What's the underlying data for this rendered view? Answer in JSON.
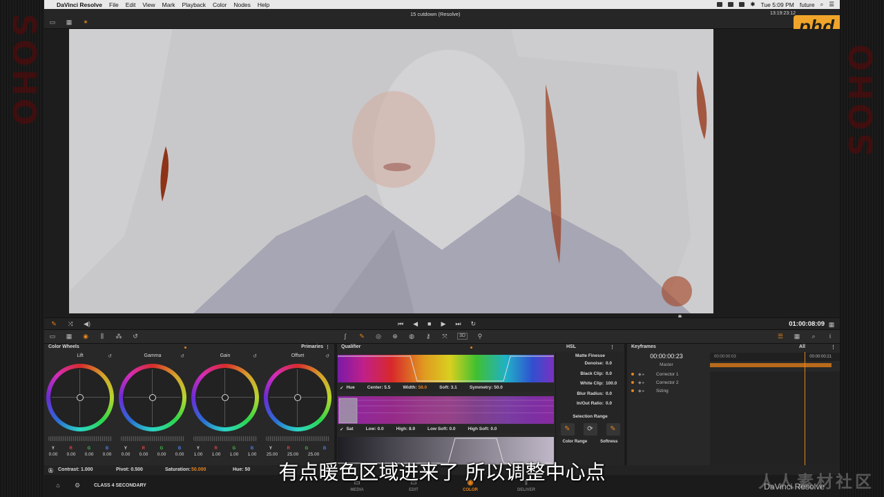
{
  "menubar": {
    "app": "DaVinci Resolve",
    "items": [
      "File",
      "Edit",
      "View",
      "Mark",
      "Playback",
      "Color",
      "Nodes",
      "Help"
    ],
    "clock": "Tue 5:09 PM",
    "user": "future"
  },
  "topbar": {
    "project_title": "15 cutdown (Resolve)",
    "timecode": "13:19:23:12",
    "logo": "phd"
  },
  "transport": {
    "timecode": "01:00:08:09"
  },
  "color_wheels": {
    "title": "Color Wheels",
    "mode": "Primaries",
    "wheels": [
      {
        "name": "Lift",
        "values": [
          "0.00",
          "0.00",
          "0.00",
          "0.00"
        ]
      },
      {
        "name": "Gamma",
        "values": [
          "0.00",
          "0.00",
          "0.00",
          "0.00"
        ]
      },
      {
        "name": "Gain",
        "values": [
          "1.00",
          "1.00",
          "1.00",
          "1.00"
        ]
      },
      {
        "name": "Offset",
        "values": [
          "25.00",
          "25.00",
          "25.00",
          ""
        ]
      }
    ],
    "channels": [
      "Y",
      "R",
      "G",
      "B"
    ]
  },
  "qualifier": {
    "title": "Qualifier",
    "mode": "HSL",
    "hue": {
      "label": "Hue",
      "center": "Center: 5.5",
      "width_label": "Width:",
      "width_value": "58.0",
      "soft": "Soft: 3.1",
      "symmetry": "Symmetry: 50.0"
    },
    "sat": {
      "label": "Sat",
      "low": "Low: 0.0",
      "high": "High: 8.9",
      "low_soft": "Low Soft: 0.0",
      "high_soft": "High Soft: 0.0"
    }
  },
  "matte_finesse": {
    "title": "Matte Finesse",
    "rows": [
      {
        "label": "Denoise:",
        "value": "0.0"
      },
      {
        "label": "Black Clip:",
        "value": "0.0"
      },
      {
        "label": "White Clip:",
        "value": "100.0"
      },
      {
        "label": "Blur Radius:",
        "value": "0.0"
      },
      {
        "label": "In/Out Ratio:",
        "value": "0.0"
      }
    ],
    "selection_range": "Selection Range",
    "color_range": "Color Range",
    "softness": "Softness"
  },
  "keyframes": {
    "title": "Keyframes",
    "filter": "All",
    "timecode": "00:00:00:23",
    "ruler_start": "00:00:00:03",
    "ruler_end": "00:00:00:21",
    "master": "Master",
    "rows": [
      "Corrector 1",
      "Corrector 2",
      "Sizing"
    ]
  },
  "status": {
    "contrast": "Contrast: 1.000",
    "pivot": "Pivot: 0.500",
    "saturation_label": "Saturation:",
    "saturation_value": "50.000",
    "hue": "Hue: 50"
  },
  "pagebar": {
    "project": "CLASS 4 SECONDARY",
    "pages": [
      "MEDIA",
      "EDIT",
      "COLOR",
      "DELIVER"
    ],
    "active": "COLOR",
    "brand": "DaVinci Resolve"
  },
  "subtitle": "有点暖色区域进来了 所以调整中心点",
  "watermark": "人人素材社区",
  "colors": {
    "accent": "#e8851b",
    "viewer_bg": "#c9c9cb",
    "panel": "#282828"
  }
}
